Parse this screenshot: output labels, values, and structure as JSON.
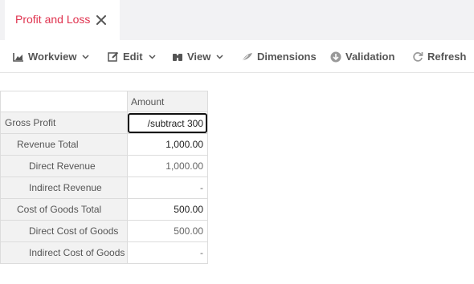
{
  "tab": {
    "label": "Profit and Loss"
  },
  "toolbar": {
    "workview": "Workview",
    "edit": "Edit",
    "view": "View",
    "dimensions": "Dimensions",
    "validation": "Validation",
    "refresh": "Refresh"
  },
  "grid": {
    "column_header": "Amount",
    "editing_value": "/subtract 300",
    "rows": [
      {
        "label": "Gross Profit",
        "value": ""
      },
      {
        "label": "Revenue Total",
        "value": "1,000.00"
      },
      {
        "label": "Direct Revenue",
        "value": "1,000.00"
      },
      {
        "label": "Indirect Revenue",
        "value": "-"
      },
      {
        "label": "Cost of Goods Total",
        "value": "500.00"
      },
      {
        "label": "Direct Cost of Goods",
        "value": "500.00"
      },
      {
        "label": "Indirect Cost of Goods",
        "value": "-"
      }
    ]
  },
  "colors": {
    "accent": "#e0334f",
    "toolbar_text": "#555555",
    "header_bg": "#f2f2f2"
  },
  "icons": [
    "close-icon",
    "chart-icon",
    "chevron-down-icon",
    "edit-icon",
    "binoculars-icon",
    "feather-icon",
    "download-circle-icon",
    "refresh-icon"
  ]
}
